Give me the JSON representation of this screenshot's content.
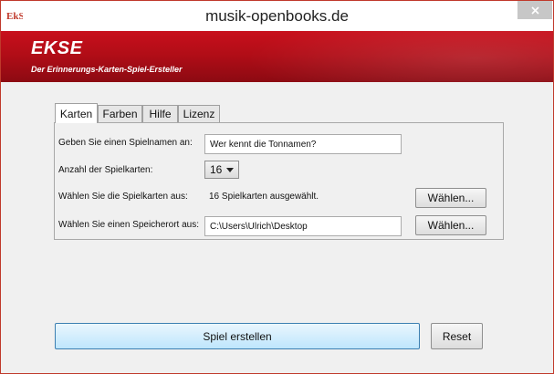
{
  "window": {
    "title": "musik-openbooks.de",
    "icon": "ekse-logo-icon",
    "close_icon": "close-icon"
  },
  "banner": {
    "brand": "EKSE",
    "tagline": "Der Erinnerungs-Karten-Spiel-Ersteller",
    "color": "#b20d17"
  },
  "tabs": [
    {
      "label": "Karten",
      "active": true
    },
    {
      "label": "Farben",
      "active": false
    },
    {
      "label": "Hilfe",
      "active": false
    },
    {
      "label": "Lizenz",
      "active": false
    }
  ],
  "form": {
    "game_name": {
      "label": "Geben Sie einen Spielnamen an:",
      "value": "Wer kennt die Tonnamen?"
    },
    "card_count": {
      "label": "Anzahl der Spielkarten:",
      "value": "16"
    },
    "cards": {
      "label": "Wählen Sie die Spielkarten aus:",
      "status": "16 Spielkarten ausgewählt.",
      "button": "Wählen..."
    },
    "location": {
      "label": "Wählen Sie einen Speicherort aus:",
      "value": "C:\\Users\\Ulrich\\Desktop",
      "button": "Wählen..."
    }
  },
  "actions": {
    "create": "Spiel erstellen",
    "reset": "Reset"
  }
}
